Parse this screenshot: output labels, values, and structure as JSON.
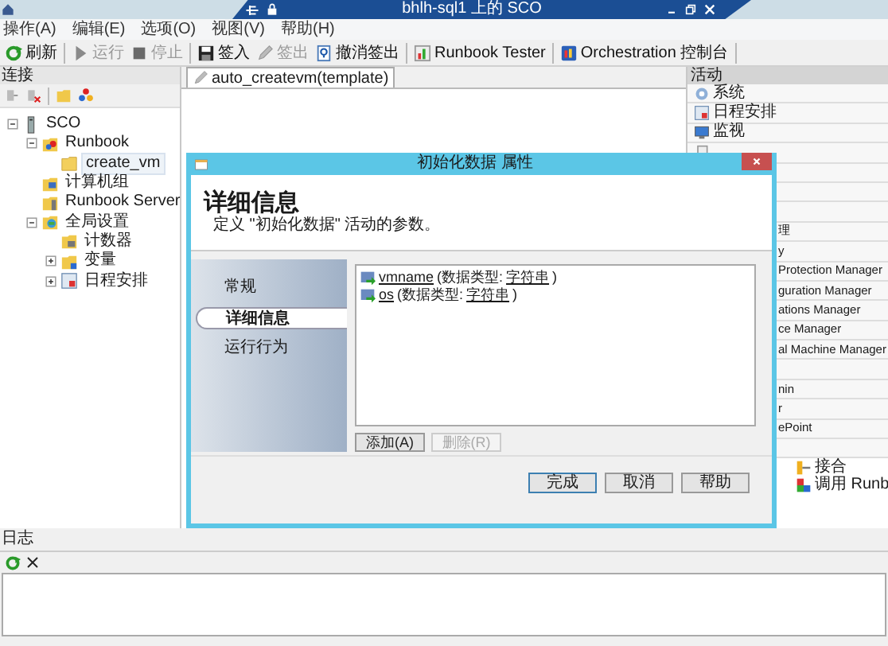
{
  "window": {
    "title": "bhlh-sql1 上的 SCO"
  },
  "menu": [
    "操作(A)",
    "编辑(E)",
    "选项(O)",
    "视图(V)",
    "帮助(H)"
  ],
  "toolbar": [
    {
      "label": "刷新",
      "disabled": false
    },
    {
      "label": "运行",
      "disabled": true
    },
    {
      "label": "停止",
      "disabled": true
    },
    {
      "label": "签入",
      "disabled": false
    },
    {
      "label": "签出",
      "disabled": true
    },
    {
      "label": "撤消签出",
      "disabled": false
    },
    {
      "label": "Runbook Tester",
      "disabled": false
    },
    {
      "label": "Orchestration 控制台",
      "disabled": false
    }
  ],
  "connections": {
    "title": "连接",
    "tree": [
      {
        "label": "SCO",
        "kind": "server",
        "expanded": true,
        "selected": false,
        "children": [
          {
            "label": "Runbook",
            "kind": "runbook",
            "expanded": true,
            "selected": false,
            "children": [
              {
                "label": "create_vm",
                "kind": "folder",
                "selected": true
              }
            ]
          },
          {
            "label": "计算机组",
            "kind": "computers",
            "selected": false
          },
          {
            "label": "Runbook Server",
            "kind": "rbserver",
            "selected": false
          },
          {
            "label": "全局设置",
            "kind": "globe",
            "expanded": true,
            "selected": false,
            "children": [
              {
                "label": "计数器",
                "kind": "counter",
                "selected": false
              },
              {
                "label": "变量",
                "kind": "variable",
                "expanded": false,
                "selected": false
              },
              {
                "label": "日程安排",
                "kind": "schedule",
                "expanded": false,
                "selected": false
              }
            ]
          }
        ]
      }
    ]
  },
  "designer": {
    "tab": "auto_createvm(template)"
  },
  "activities": {
    "title": "活动",
    "rows": [
      {
        "kind": "item",
        "text": "系统"
      },
      {
        "kind": "item",
        "text": "日程安排"
      },
      {
        "kind": "item",
        "text": "监视"
      },
      {
        "kind": "item"
      },
      {
        "kind": "partial"
      },
      {
        "kind": "partial"
      },
      {
        "kind": "partial"
      },
      {
        "kind": "partial",
        "text": "理"
      },
      {
        "kind": "partial",
        "text": "y"
      },
      {
        "kind": "partial",
        "text": "Protection Manager"
      },
      {
        "kind": "partial",
        "text": "guration Manager"
      },
      {
        "kind": "partial",
        "text": "ations Manager"
      },
      {
        "kind": "partial",
        "text": "ce Manager"
      },
      {
        "kind": "partial",
        "text": "al Machine Manager"
      },
      {
        "kind": "partial"
      },
      {
        "kind": "partial",
        "text": "nin"
      },
      {
        "kind": "partial",
        "text": "r"
      },
      {
        "kind": "partial",
        "text": "ePoint"
      },
      {
        "kind": "partial"
      },
      {
        "kind": "sub",
        "text": "接合"
      },
      {
        "kind": "sub",
        "text": "调用 Runb"
      }
    ]
  },
  "dialog": {
    "title": "初始化数据 属性",
    "heading": "详细信息",
    "description": "定义 \"初始化数据\" 活动的参数。",
    "nav": [
      {
        "label": "常规",
        "selected": false
      },
      {
        "label": "详细信息",
        "selected": true
      },
      {
        "label": "运行行为",
        "selected": false
      }
    ],
    "parameters": [
      {
        "name": "vmname",
        "type_prefix": "(数据类型:",
        "type": "字符串",
        "suffix": ")"
      },
      {
        "name": "os",
        "type_prefix": "(数据类型:",
        "type": "字符串",
        "suffix": ")"
      }
    ],
    "list_buttons": [
      {
        "label": "添加(A)",
        "disabled": false
      },
      {
        "label": "删除(R)",
        "disabled": true
      }
    ],
    "buttons": [
      {
        "label": "完成",
        "default": true
      },
      {
        "label": "取消",
        "default": false
      },
      {
        "label": "帮助",
        "default": false
      }
    ]
  },
  "log": {
    "title": "日志"
  }
}
